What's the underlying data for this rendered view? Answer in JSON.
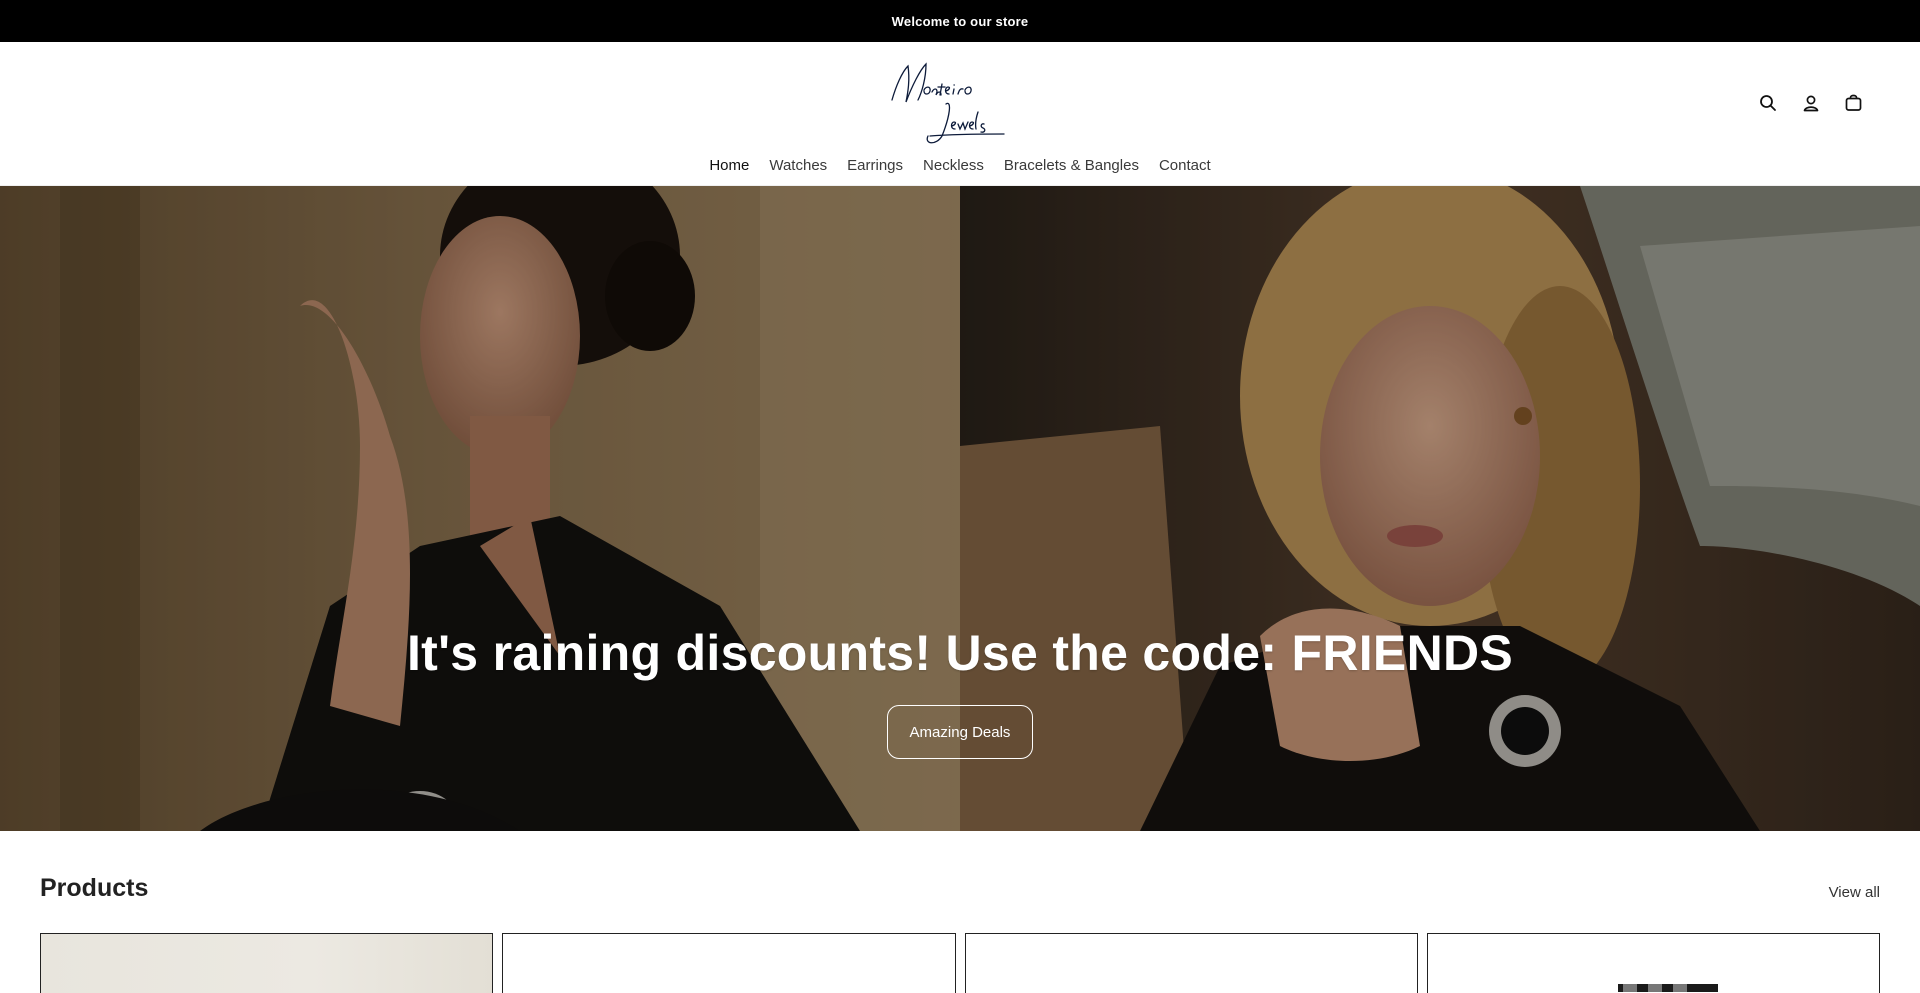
{
  "announcement": {
    "text": "Welcome to our store"
  },
  "header": {
    "logo_alt": "Monteiro Jewels",
    "icons": [
      "search-icon",
      "account-icon",
      "cart-icon"
    ]
  },
  "nav": {
    "items": [
      {
        "label": "Home",
        "active": true
      },
      {
        "label": "Watches"
      },
      {
        "label": "Earrings"
      },
      {
        "label": "Neckless"
      },
      {
        "label": "Bracelets & Bangles"
      },
      {
        "label": "Contact"
      }
    ]
  },
  "hero": {
    "title": "It's raining discounts! Use the code: FRIENDS",
    "button_label": "Amazing Deals"
  },
  "products": {
    "heading": "Products",
    "view_all_label": "View all",
    "card_count": 4
  },
  "colors": {
    "announcement_bg": "#000000",
    "text": "#1a1a1a",
    "accent_white": "#ffffff"
  }
}
